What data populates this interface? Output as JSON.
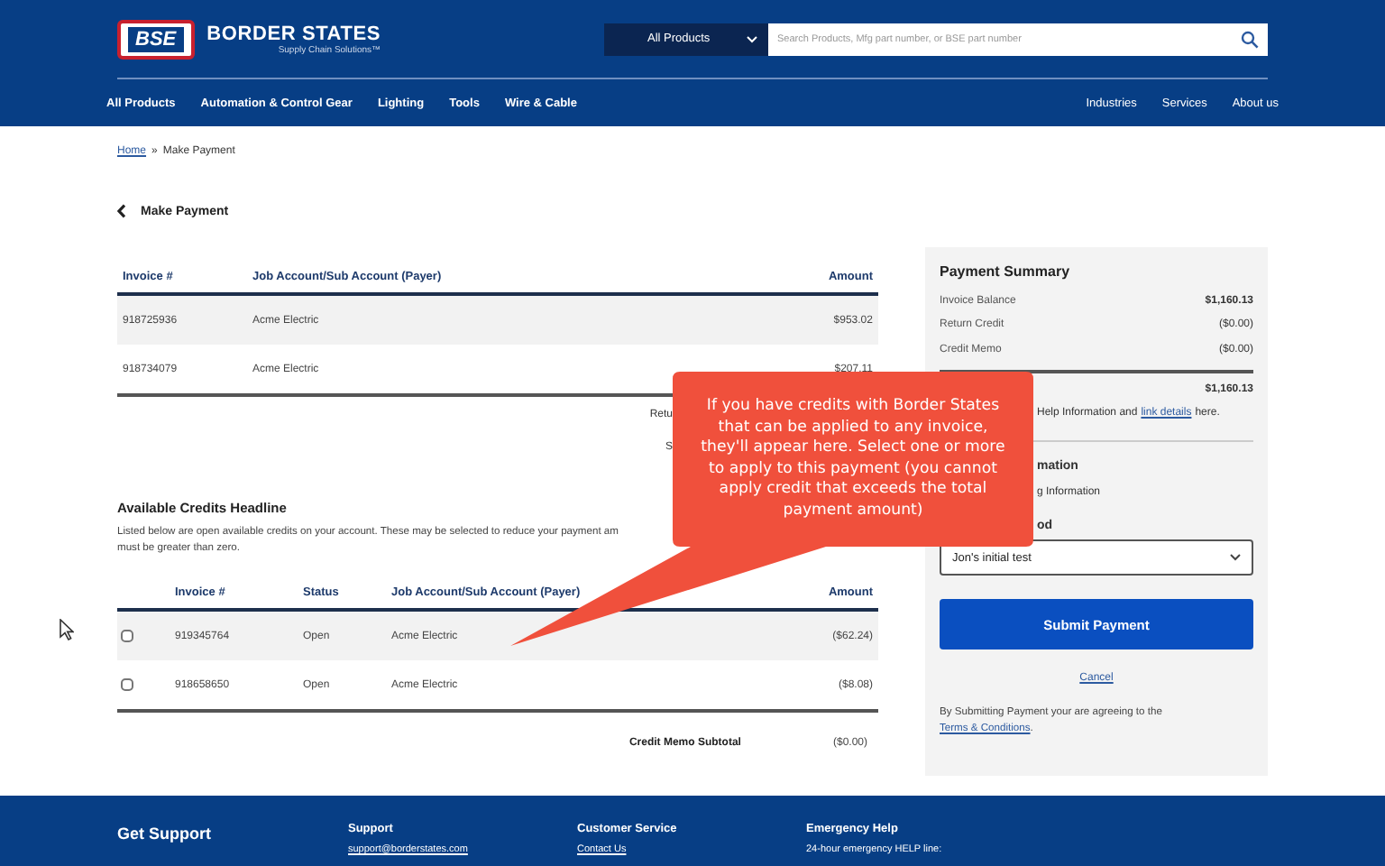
{
  "header": {
    "logo": {
      "mark": "BSE",
      "name": "BORDER STATES",
      "tagline": "Supply Chain Solutions™"
    },
    "search": {
      "category": "All Products",
      "placeholder": "Search Products, Mfg part number, or BSE part number"
    },
    "nav_left": [
      "All Products",
      "Automation & Control Gear",
      "Lighting",
      "Tools",
      "Wire & Cable"
    ],
    "nav_right": [
      "Industries",
      "Services",
      "About us"
    ]
  },
  "breadcrumb": {
    "items": [
      {
        "label": "Home",
        "link": true
      },
      {
        "label": "Make Payment",
        "link": false
      }
    ],
    "separator": "»"
  },
  "page_title": "Make Payment",
  "invoices": {
    "columns": [
      "Invoice #",
      "Job Account/Sub Account (Payer)",
      "Amount"
    ],
    "rows": [
      {
        "invoice": "918725936",
        "account": "Acme Electric",
        "amount": "$953.02"
      },
      {
        "invoice": "918734079",
        "account": "Acme Electric",
        "amount": "$207.11"
      }
    ],
    "totals_fragments": [
      "Retu",
      "S"
    ]
  },
  "credits": {
    "headline": "Available Credits Headline",
    "description_lines": [
      "Listed below are open available credits on your account. These may be selected to reduce your payment am",
      "must be greater than zero."
    ],
    "columns": [
      "Invoice #",
      "Status",
      "Job Account/Sub Account (Payer)",
      "Amount"
    ],
    "rows": [
      {
        "checked": false,
        "invoice": "919345764",
        "status": "Open",
        "account": "Acme Electric",
        "amount": "($62.24)"
      },
      {
        "checked": false,
        "invoice": "918658650",
        "status": "Open",
        "account": "Acme Electric",
        "amount": "($8.08)"
      }
    ],
    "subtotal_label": "Credit Memo Subtotal",
    "subtotal_value": "($0.00)"
  },
  "summary": {
    "title": "Payment Summary",
    "rows": [
      {
        "label": "Invoice Balance",
        "value": "$1,160.13",
        "bold": true
      },
      {
        "label": "Return Credit",
        "value": "($0.00)",
        "bold": false
      },
      {
        "label": "Credit Memo",
        "value": "($0.00)",
        "bold": false
      }
    ],
    "total_value": "$1,160.13",
    "help_text": "Help Information and",
    "help_link": "link details",
    "help_end": "here.",
    "info_title_fragment": "mation",
    "info_text_fragment": "g Information",
    "method_label_fragment": "od",
    "method_value": "Jon's initial test",
    "submit": "Submit Payment",
    "cancel": "Cancel",
    "terms_text": "By Submitting Payment your are agreeing to the",
    "terms_link": "Terms & Conditions",
    "terms_end": "."
  },
  "callout": "If you have credits with Border States that can be applied to any invoice, they'll appear here. Select one or more to apply to this payment (you cannot apply credit that exceeds the total payment amount)",
  "footer": [
    {
      "title": "Get Support",
      "kind": "heading"
    },
    {
      "title": "Support",
      "kind": "link",
      "text": "support@borderstates.com"
    },
    {
      "title": "Customer Service",
      "kind": "link",
      "text": "Contact Us"
    },
    {
      "title": "Emergency Help",
      "kind": "text",
      "text": "24-hour emergency HELP line:"
    }
  ]
}
